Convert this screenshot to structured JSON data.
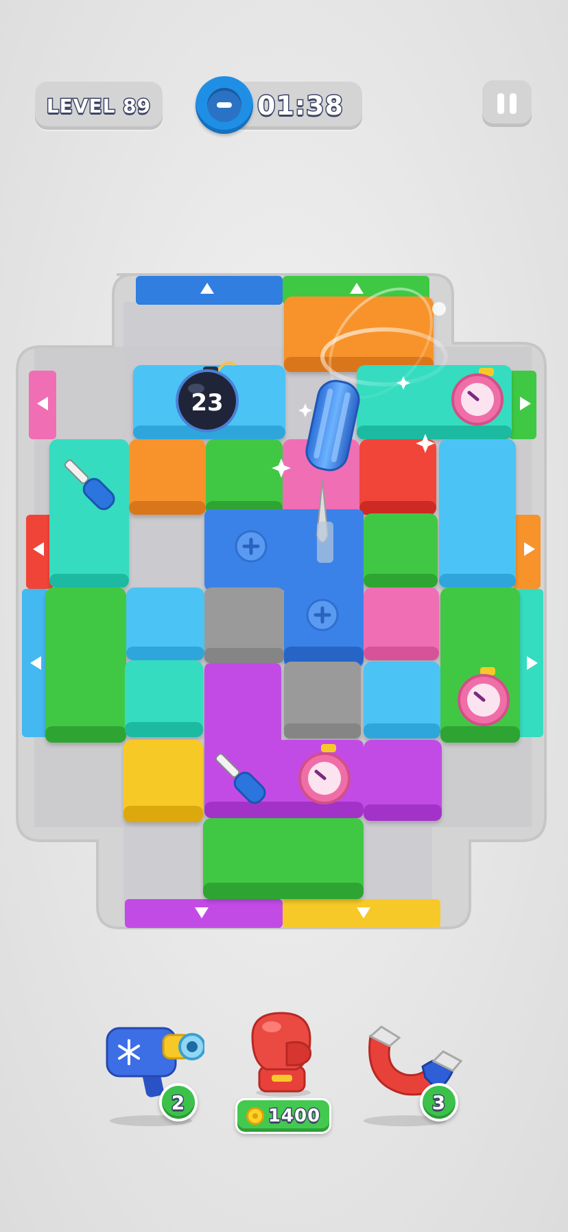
{
  "hud": {
    "level_label": "LEVEL 89",
    "timer": "01:38",
    "timer_icon": "minus-clock-icon",
    "pause_icon": "pause-icon"
  },
  "board": {
    "bomb_counter": "23",
    "colors": {
      "blue": "#3b82e8",
      "sky": "#4cc3f5",
      "green": "#44c83f",
      "orange": "#f7932a",
      "red": "#f04438",
      "pink": "#f06eb4",
      "teal": "#34dcc0",
      "purple": "#c24be6",
      "yellow": "#f7c928",
      "gray": "#9a9a9a",
      "frame": "#d3d3d3"
    }
  },
  "boosters": [
    {
      "name": "freeze-gun",
      "icon": "freeze-blaster-icon",
      "count": "2"
    },
    {
      "name": "boxing-glove",
      "icon": "boxing-glove-icon",
      "price": "1400"
    },
    {
      "name": "magnet",
      "icon": "magnet-icon",
      "count": "3"
    }
  ]
}
